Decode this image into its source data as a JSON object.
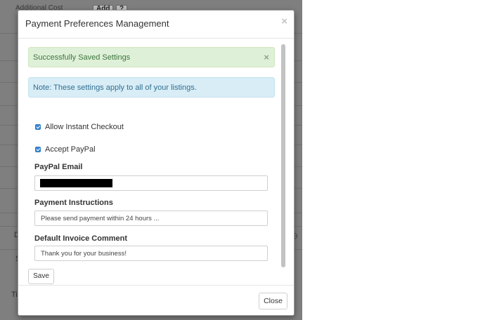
{
  "background": {
    "header_cell_text": "Additional Cost",
    "add_button_label": "Add",
    "help_button_label": "?",
    "side_letters": [
      "D",
      "S",
      "Ti"
    ]
  },
  "modal": {
    "title": "Payment Preferences Management",
    "close_glyph": "×",
    "alerts": {
      "success_text": "Successfully Saved Settings",
      "success_close_glyph": "×",
      "info_text": "Note: These settings apply to all of your listings."
    },
    "checkboxes": [
      {
        "label": "Allow Instant Checkout",
        "checked": true
      },
      {
        "label": "Accept PayPal",
        "checked": true
      }
    ],
    "fields": {
      "paypal_email_label": "PayPal Email",
      "paypal_email_value": "",
      "payment_instructions_label": "Payment Instructions",
      "payment_instructions_value": "Please send payment within 24 hours ...",
      "invoice_comment_label": "Default Invoice Comment",
      "invoice_comment_value": "Thank you for your business!"
    },
    "save_label": "Save",
    "footer_close_label": "Close"
  },
  "colors": {
    "backdrop": "#7f7f7f",
    "success_bg": "#dff0d8",
    "success_text": "#3c763d",
    "info_bg": "#d9edf7",
    "info_text": "#31708f",
    "checkbox_accent": "#3b8bd8"
  },
  "icons": {
    "modal_close": "close-icon",
    "alert_close": "close-icon",
    "checkbox": "checkbox-checked-icon"
  }
}
